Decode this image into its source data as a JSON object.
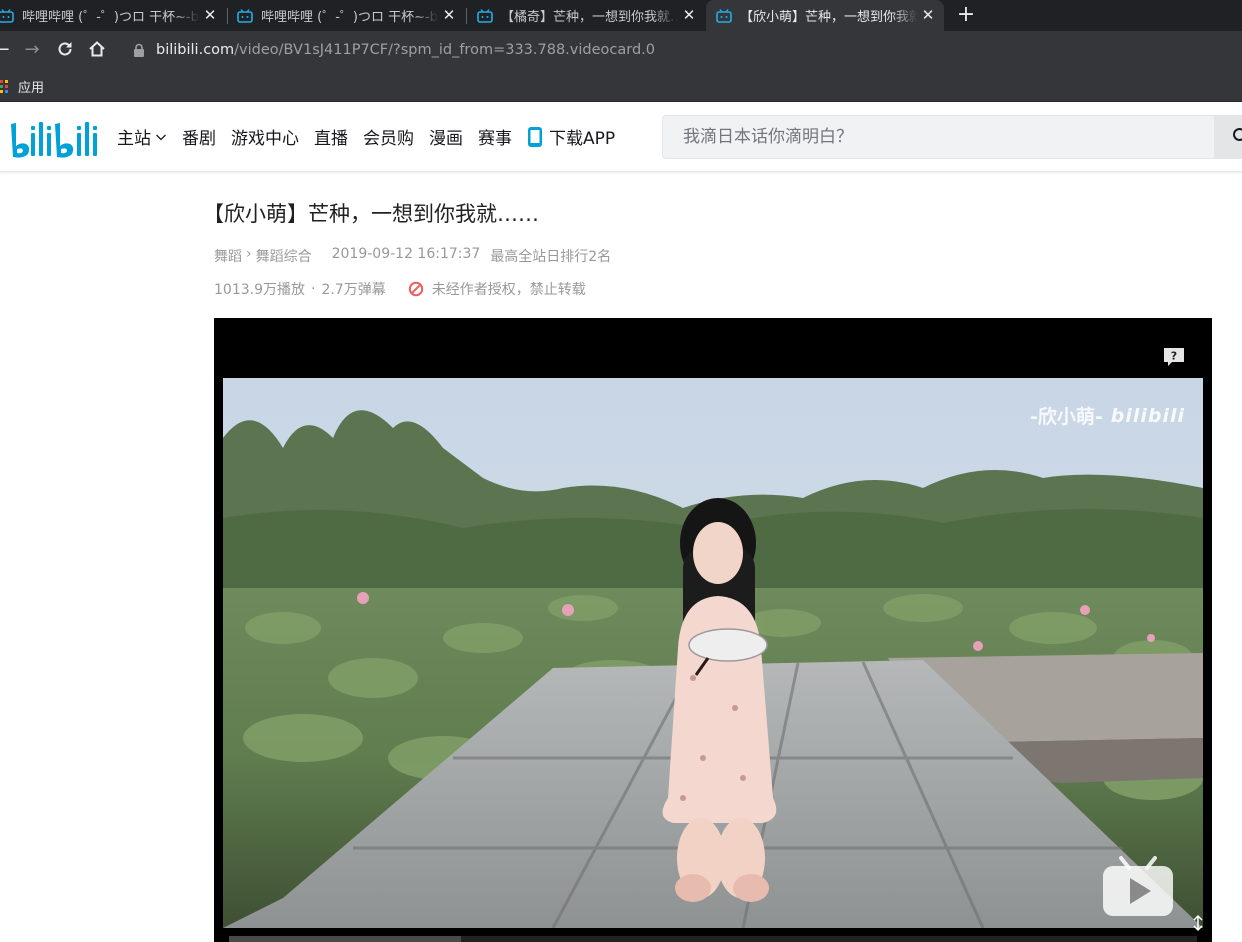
{
  "browser": {
    "tabs": [
      {
        "title": "哔哩哔哩 (゜-゜)つロ 干杯~-bilibili",
        "active": false,
        "icon": "bilibili-tv-icon"
      },
      {
        "title": "哔哩哔哩 (゜-゜)つロ 干杯~-bilibili",
        "active": false,
        "icon": "bilibili-tv-icon"
      },
      {
        "title": "【橘奇】芒种，一想到你我就……",
        "active": false,
        "icon": "bilibili-tv-icon"
      },
      {
        "title": "【欣小萌】芒种，一想到你我就……",
        "active": true,
        "icon": "bilibili-tv-icon"
      }
    ],
    "url_host": "bilibili.com",
    "url_path": "/video/BV1sJ411P7CF/?spm_id_from=333.788.videocard.0",
    "bookmarks": {
      "apps_label": "应用"
    }
  },
  "header": {
    "logo_text": "bilibili",
    "nav": [
      "主站",
      "番剧",
      "游戏中心",
      "直播",
      "会员购",
      "漫画",
      "赛事",
      "下载APP"
    ],
    "search_placeholder": "我滴日本话你滴明白？"
  },
  "video": {
    "title": "【欣小萌】芒种，一想到你我就……",
    "category": "舞蹈",
    "subcategory": "舞蹈综合",
    "date": "2019-09-12 16:17:37",
    "rank": "最高全站日排行2名",
    "views": "1013.9万播放",
    "danmaku": "2.7万弹幕",
    "copyright_notice": "未经作者授权，禁止转载",
    "watermark_name": "-欣小萌-",
    "watermark_logo": "bilibili",
    "progress": 0.24
  },
  "colors": {
    "brand": "#00a1d6",
    "ban": "#f25d5d"
  }
}
